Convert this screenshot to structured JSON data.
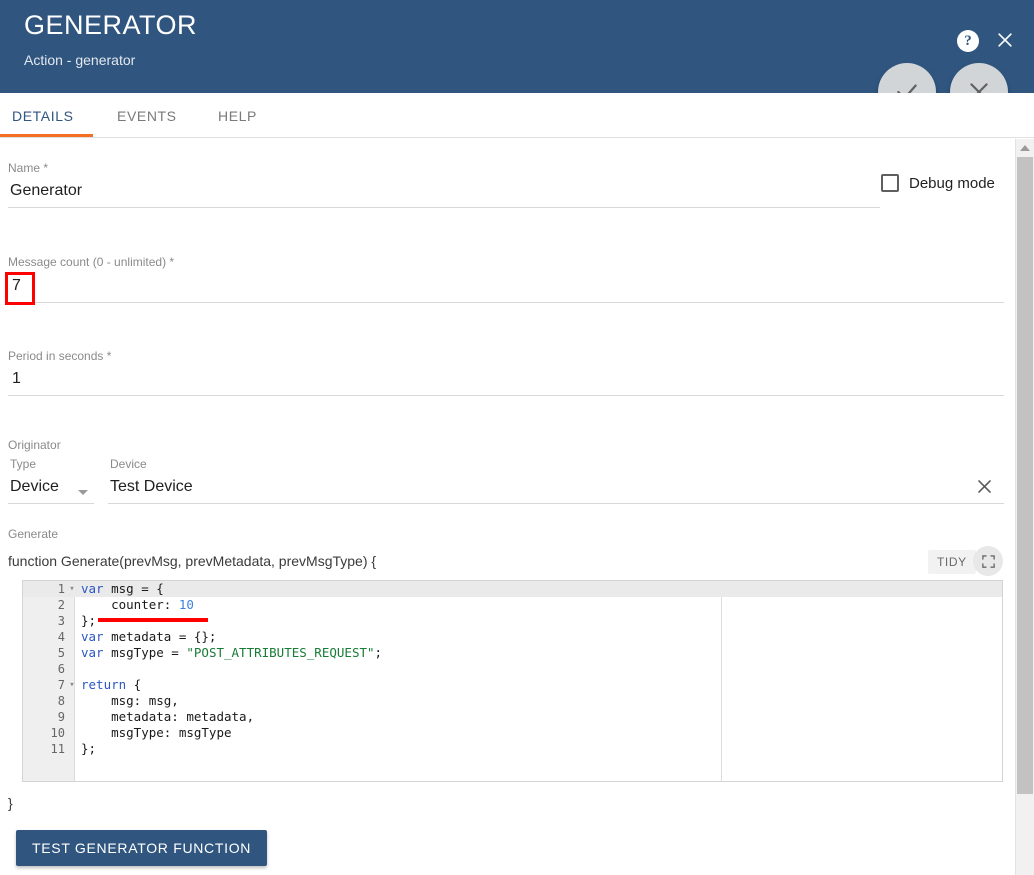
{
  "header": {
    "title": "GENERATOR",
    "subtitle": "Action - generator",
    "help_icon": "help-icon",
    "close_icon": "close-icon",
    "accept_icon": "check-icon",
    "cancel_icon": "x-icon",
    "bg_color": "#305680"
  },
  "tabs": [
    {
      "label": "DETAILS",
      "active": true
    },
    {
      "label": "EVENTS",
      "active": false
    },
    {
      "label": "HELP",
      "active": false
    }
  ],
  "tab_accent_color": "#f36f21",
  "form": {
    "name": {
      "label": "Name *",
      "value": "Generator"
    },
    "debug_mode": {
      "label": "Debug mode",
      "checked": false
    },
    "message_count": {
      "label": "Message count (0 - unlimited) *",
      "value": "7",
      "highlighted": true
    },
    "period": {
      "label": "Period in seconds *",
      "value": "1"
    },
    "originator": {
      "group_label": "Originator",
      "type": {
        "label": "Type",
        "value": "Device"
      },
      "device": {
        "label": "Device",
        "value": "Test Device",
        "clear_icon": "close-icon"
      }
    }
  },
  "generate": {
    "section_label": "Generate",
    "function_signature": "function Generate(prevMsg, prevMetadata, prevMsgType) {",
    "closing_brace": "}",
    "tidy_label": "TIDY",
    "expand_icon": "fullscreen-icon",
    "code_lines": [
      {
        "n": 1,
        "fold": true,
        "active": true,
        "tokens": [
          {
            "t": "var",
            "c": "kw"
          },
          {
            "t": " msg = {",
            "c": ""
          }
        ]
      },
      {
        "n": 2,
        "fold": false,
        "active": false,
        "tokens": [
          {
            "t": "    counter: ",
            "c": ""
          },
          {
            "t": "10",
            "c": "num"
          }
        ]
      },
      {
        "n": 3,
        "fold": false,
        "active": false,
        "tokens": [
          {
            "t": "};",
            "c": ""
          }
        ]
      },
      {
        "n": 4,
        "fold": false,
        "active": false,
        "tokens": [
          {
            "t": "var",
            "c": "kw"
          },
          {
            "t": " metadata = {};",
            "c": ""
          }
        ]
      },
      {
        "n": 5,
        "fold": false,
        "active": false,
        "tokens": [
          {
            "t": "var",
            "c": "kw"
          },
          {
            "t": " msgType = ",
            "c": ""
          },
          {
            "t": "\"POST_ATTRIBUTES_REQUEST\"",
            "c": "str"
          },
          {
            "t": ";",
            "c": ""
          }
        ]
      },
      {
        "n": 6,
        "fold": false,
        "active": false,
        "tokens": [
          {
            "t": "",
            "c": ""
          }
        ]
      },
      {
        "n": 7,
        "fold": true,
        "active": false,
        "tokens": [
          {
            "t": "return",
            "c": "kw"
          },
          {
            "t": " {",
            "c": ""
          }
        ]
      },
      {
        "n": 8,
        "fold": false,
        "active": false,
        "tokens": [
          {
            "t": "    msg: msg,",
            "c": ""
          }
        ]
      },
      {
        "n": 9,
        "fold": false,
        "active": false,
        "tokens": [
          {
            "t": "    metadata: metadata,",
            "c": ""
          }
        ]
      },
      {
        "n": 10,
        "fold": false,
        "active": false,
        "tokens": [
          {
            "t": "    msgType: msgType",
            "c": ""
          }
        ]
      },
      {
        "n": 11,
        "fold": false,
        "active": false,
        "tokens": [
          {
            "t": "};",
            "c": ""
          }
        ]
      }
    ]
  },
  "test_button": {
    "label": "TEST GENERATOR FUNCTION"
  },
  "annotations": {
    "color": "#ff0000",
    "highlight_box_target": "message-count-value",
    "underline_target": "code-line-3"
  },
  "scrollbar": {
    "up_arrow_icon": "chevron-up-icon"
  }
}
